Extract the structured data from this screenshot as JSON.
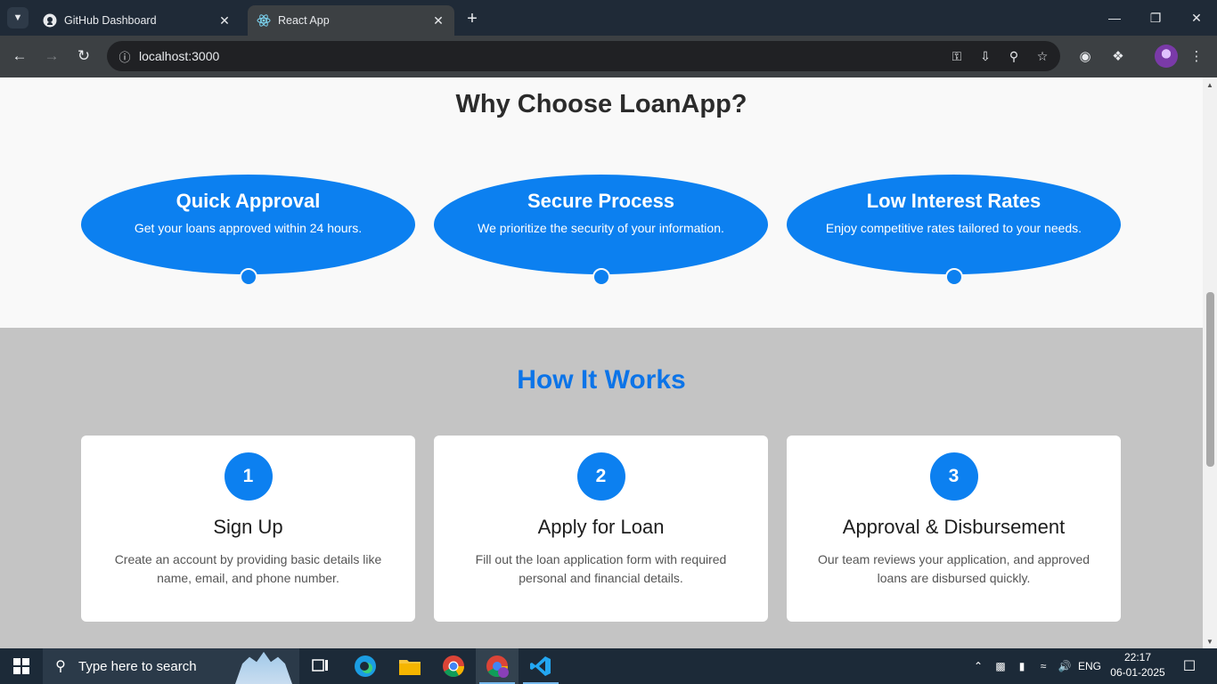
{
  "browser": {
    "tabs": [
      {
        "title": "GitHub Dashboard",
        "favicon": "github-icon",
        "active": false
      },
      {
        "title": "React App",
        "favicon": "react-icon",
        "active": true
      }
    ],
    "url": "localhost:3000"
  },
  "page": {
    "why_title": "Why Choose LoanApp?",
    "features": [
      {
        "title": "Quick Approval",
        "desc": "Get your loans approved within 24 hours."
      },
      {
        "title": "Secure Process",
        "desc": "We prioritize the security of your information."
      },
      {
        "title": "Low Interest Rates",
        "desc": "Enjoy competitive rates tailored to your needs."
      }
    ],
    "how_title": "How It Works",
    "steps": [
      {
        "num": "1",
        "title": "Sign Up",
        "desc": "Create an account by providing basic details like name, email, and phone number."
      },
      {
        "num": "2",
        "title": "Apply for Loan",
        "desc": "Fill out the loan application form with required personal and financial details."
      },
      {
        "num": "3",
        "title": "Approval & Disbursement",
        "desc": "Our team reviews your application, and approved loans are disbursed quickly."
      }
    ]
  },
  "taskbar": {
    "search_placeholder": "Type here to search",
    "language": "ENG",
    "time": "22:17",
    "date": "06-01-2025"
  },
  "colors": {
    "accent": "#0c80f0",
    "heading_blue": "#0c74e8",
    "section_gray": "#c4c4c4"
  }
}
